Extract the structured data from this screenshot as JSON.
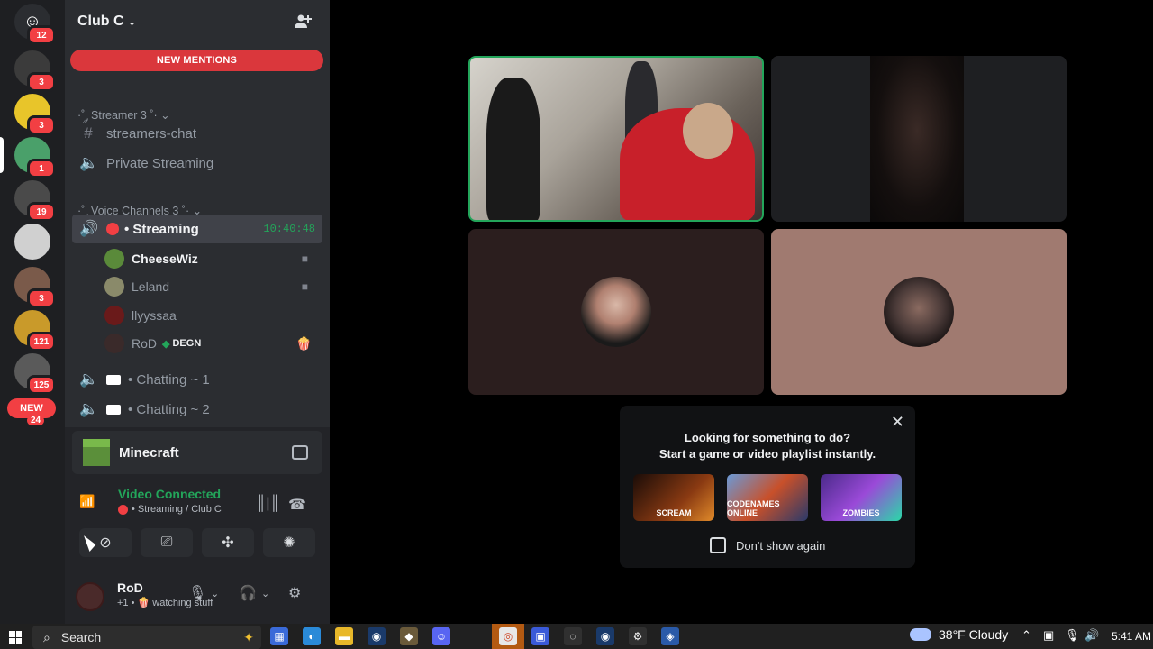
{
  "rail": {
    "home_badge": "12",
    "guilds": [
      {
        "name": "guild-prime",
        "badge": "3",
        "color": "#3b3b3b"
      },
      {
        "name": "guild-yellow-face",
        "badge": "3",
        "color": "#e8c52a"
      },
      {
        "name": "guild-club-c",
        "badge": "1",
        "color": "#4aa06a"
      },
      {
        "name": "guild-wings",
        "badge": "19",
        "color": "#4a4a4a"
      },
      {
        "name": "guild-emblem",
        "badge": "",
        "color": "#d0d0d0"
      },
      {
        "name": "guild-room",
        "badge": "3",
        "color": "#7a5a4a"
      },
      {
        "name": "guild-gold",
        "badge": "121",
        "color": "#c99a2a"
      },
      {
        "name": "guild-gray",
        "badge": "125",
        "color": "#5a5a5a"
      }
    ],
    "new_label": "NEW",
    "new_count": "24"
  },
  "server": {
    "name": "Club C"
  },
  "mentions_label": "NEW MENTIONS",
  "categories": {
    "streamer": "·˚ ༘ Streamer 3 ˚·",
    "voice": "·˚ ༘ Voice Channels 3 ˚·"
  },
  "channels": {
    "streamers_chat": "streamers-chat",
    "private_streaming": "Private Streaming",
    "streaming": "• Streaming",
    "streaming_timer": "10:40:48",
    "chatting1": "• Chatting ~ 1",
    "chatting2": "• Chatting ~ 2"
  },
  "members": [
    {
      "name": "CheeseWiz",
      "bright": true,
      "color": "#5a8a3a",
      "cam": true
    },
    {
      "name": "Leland",
      "bright": false,
      "color": "#8a8a6a",
      "cam": true
    },
    {
      "name": "llyyssaa",
      "bright": false,
      "color": "#6a1a1a",
      "cam": false
    },
    {
      "name": "RoD",
      "bright": false,
      "color": "#3a2a2a",
      "cam": false,
      "tag": "DEGN"
    }
  ],
  "activity": {
    "name": "Minecraft"
  },
  "voice": {
    "title": "Video Connected",
    "subtitle": "• Streaming / Club C"
  },
  "user": {
    "name": "RoD",
    "status": "+1 • 🍿 watching stuff"
  },
  "suggest": {
    "line1": "Looking for something to do?",
    "line2": "Start a game or video playlist instantly.",
    "games": [
      "SCREAM",
      "CODENAMES ONLINE",
      "ZOMBIES"
    ],
    "dont_show": "Don't show again"
  },
  "taskbar": {
    "search": "Search",
    "weather": "38°F Cloudy",
    "time": "5:41 AM"
  }
}
